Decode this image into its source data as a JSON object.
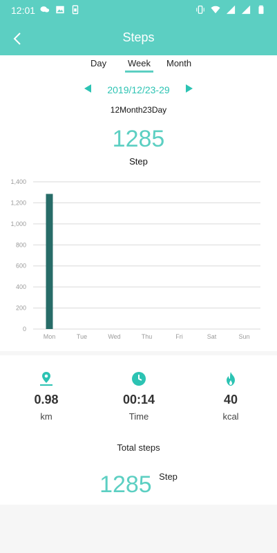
{
  "status_bar": {
    "time": "12:01"
  },
  "appbar": {
    "title": "Steps"
  },
  "tabs": [
    {
      "label": "Day",
      "active": false
    },
    {
      "label": "Week",
      "active": true
    },
    {
      "label": "Month",
      "active": false
    }
  ],
  "date_nav": {
    "range": "2019/12/23-29",
    "subtitle": "12Month23Day"
  },
  "summary": {
    "steps": "1285",
    "unit": "Step"
  },
  "chart_data": {
    "type": "bar",
    "categories": [
      "Mon",
      "Tue",
      "Wed",
      "Thu",
      "Fri",
      "Sat",
      "Sun"
    ],
    "values": [
      1285,
      0,
      0,
      0,
      0,
      0,
      0
    ],
    "ylim": [
      0,
      1400
    ],
    "yticks": [
      "0",
      "200",
      "400",
      "600",
      "800",
      "1,000",
      "1,200",
      "1,400"
    ],
    "grid": true,
    "bar_color": "#276c68"
  },
  "stats": [
    {
      "icon": "location-pin-icon",
      "value": "0.98",
      "unit": "km"
    },
    {
      "icon": "clock-icon",
      "value": "00:14",
      "unit": "Time"
    },
    {
      "icon": "flame-icon",
      "value": "40",
      "unit": "kcal"
    }
  ],
  "total": {
    "label": "Total steps",
    "value": "1285",
    "unit": "Step"
  },
  "colors": {
    "accent": "#5ccfc2",
    "accent_dark": "#2cc3b3",
    "bar": "#276c68"
  }
}
